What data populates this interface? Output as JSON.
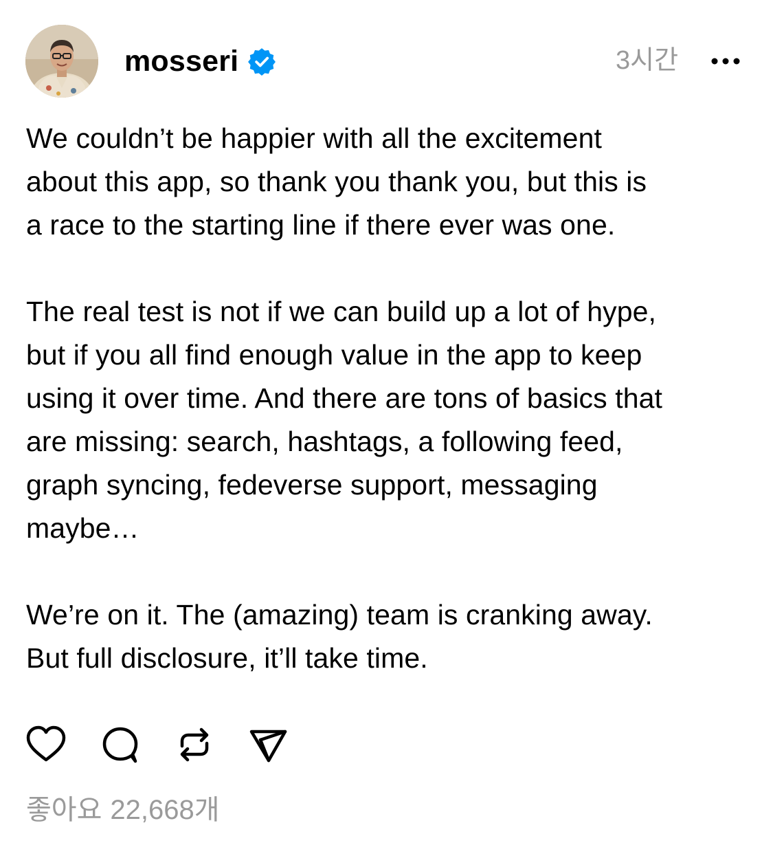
{
  "post": {
    "username": "mosseri",
    "timestamp": "3시간",
    "paragraphs": [
      "We couldn’t be happier with all the excitement\nabout this app, so thank you thank you, but this is\na race to the starting line if there ever was one.",
      "The real test is not if we can build up a lot of hype,\nbut if you all find enough value in the app to keep\nusing it over time. And there are tons of basics that\nare missing: search, hashtags, a following feed,\ngraph syncing, fedeverse support, messaging\nmaybe…",
      "We’re on it. The (amazing) team is cranking away.\nBut full disclosure, it’ll take time."
    ],
    "likes_label": "좋아요",
    "likes_count": "22,668개"
  },
  "icons": {
    "avatar": "avatar",
    "verified": "verified-badge-icon",
    "more": "more-options-icon",
    "like": "heart-icon",
    "comment": "comment-icon",
    "repost": "repost-icon",
    "share": "send-icon"
  },
  "colors": {
    "text": "#000000",
    "secondary": "#9a9a9a",
    "verified": "#0095f6",
    "background": "#ffffff"
  }
}
